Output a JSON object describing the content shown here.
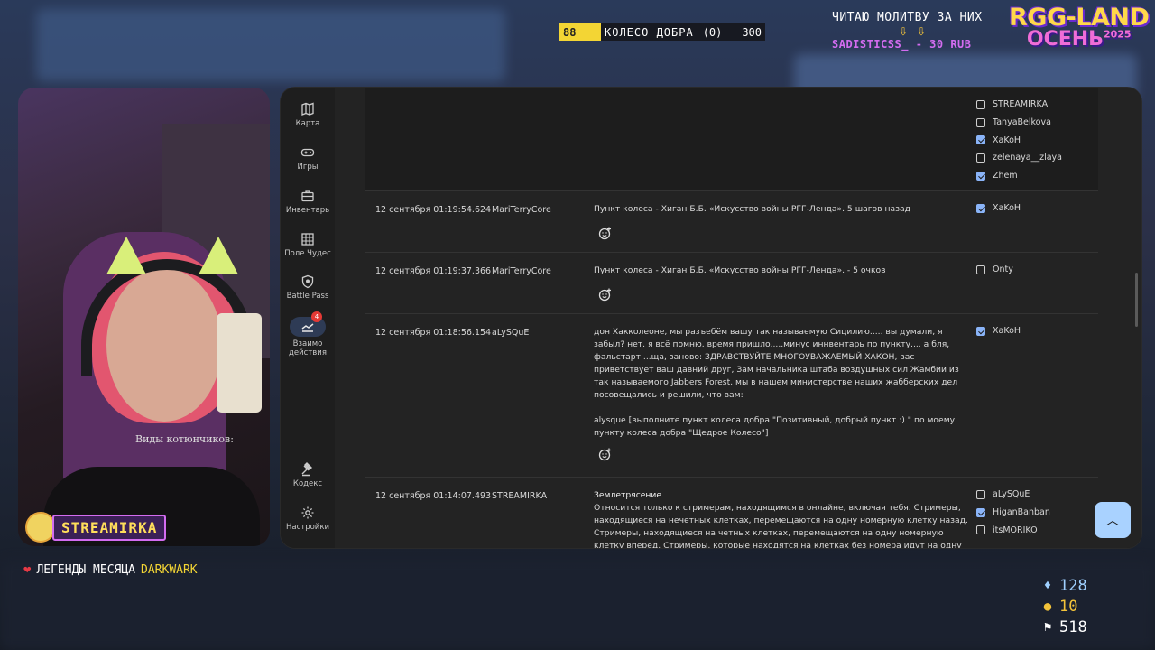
{
  "overlay": {
    "wheel": {
      "count": "88",
      "label": "КОЛЕСО ДОБРА",
      "zero": "(0)",
      "value": "300"
    },
    "prayer_text": "ЧИТАЮ МОЛИТВУ ЗА НИХ",
    "donor_text": "SADISTICSS_ - 30 RUB",
    "logo_line1": "RGG-LAND",
    "logo_line2": "ОСЕНЬ",
    "logo_year": "2025",
    "streamer_name": "STREAMIRKA",
    "legend_label": "ЛЕГЕНДЫ МЕСЯЦА",
    "legend_user": "DARKWARK",
    "shirt_text": "Виды котюнчиков:",
    "stats": {
      "gems": "128",
      "coins": "10",
      "flags": "518"
    }
  },
  "sidebar": {
    "items": [
      {
        "label": "Карта",
        "icon": "map-icon"
      },
      {
        "label": "Игры",
        "icon": "gamepad-icon"
      },
      {
        "label": "Инвентарь",
        "icon": "inventory-icon"
      },
      {
        "label": "Поле Чудес",
        "icon": "grid-icon"
      },
      {
        "label": "Battle Pass",
        "icon": "shield-icon"
      },
      {
        "label": "Взаимо действия",
        "icon": "interactions-icon",
        "badge": "4"
      },
      {
        "label": "Кодекс",
        "icon": "gavel-icon"
      },
      {
        "label": "Настройки",
        "icon": "gear-icon"
      }
    ]
  },
  "top_checks": [
    {
      "name": "STREAMIRKA",
      "checked": false
    },
    {
      "name": "TanyaBelkova",
      "checked": false
    },
    {
      "name": "XaKoH",
      "checked": true
    },
    {
      "name": "zelenaya__zlaya",
      "checked": false
    },
    {
      "name": "Zhem",
      "checked": true
    }
  ],
  "log": [
    {
      "timestamp": "12 сентября 01:19:54.624",
      "user": "MariTerryCore",
      "message": "Пункт колеса - Хиган Б.Б. «Искусство войны РГГ-Ленда». 5 шагов назад",
      "checks": [
        {
          "name": "XaKoH",
          "checked": true
        }
      ]
    },
    {
      "timestamp": "12 сентября 01:19:37.366",
      "user": "MariTerryCore",
      "message": "Пункт колеса - Хиган Б.Б. «Искусство войны РГГ-Ленда». - 5 очков",
      "checks": [
        {
          "name": "Onty",
          "checked": false
        }
      ]
    },
    {
      "timestamp": "12 сентября 01:18:56.154",
      "user": "aLySQuE",
      "message": "дон Хакколеоне, мы разъебём вашу так называемую Сицилию..... вы думали, я забыл? нет. я всё помню. время пришло.....минус иннвентарь по пункту.... а бля, фальстарт....ща, заново: ЗДРАВСТВУЙТЕ МНОГОУВАЖАЕМЫЙ ХАКОН, вас приветствует ваш давний друг, Зам начальника штаба воздушных сил Жамбии из так называемого Jabbers Forest, мы в нашем министерстве наших жабберских дел посовещались и решили, что вам:",
      "message2": "alysque [выполните пункт колеса добра \"Позитивный, добрый пункт :) \" по моему пункту колеса добра \"Щедрое Колесо\"]",
      "checks": [
        {
          "name": "XaKoH",
          "checked": true
        }
      ]
    },
    {
      "timestamp": "12 сентября 01:14:07.493",
      "user": "STREAMIRKA",
      "title": "Землетрясение",
      "message": "Относится только к стримерам, находящимся в онлайне, включая тебя. Стримеры, находящиеся на нечетных клетках, перемещаются на одну номерную клетку назад. Стримеры, находящиеся на четных клетках, перемещаются на одну номерную клетку вперед. Стримеры, которые находятся на клетках без номера идут на одну клетку",
      "checks": [
        {
          "name": "aLySQuE",
          "checked": false
        },
        {
          "name": "HiganBanban",
          "checked": true
        },
        {
          "name": "itsMORIKO",
          "checked": false
        }
      ]
    }
  ],
  "scroll_top_icon": "chevron-up-icon"
}
